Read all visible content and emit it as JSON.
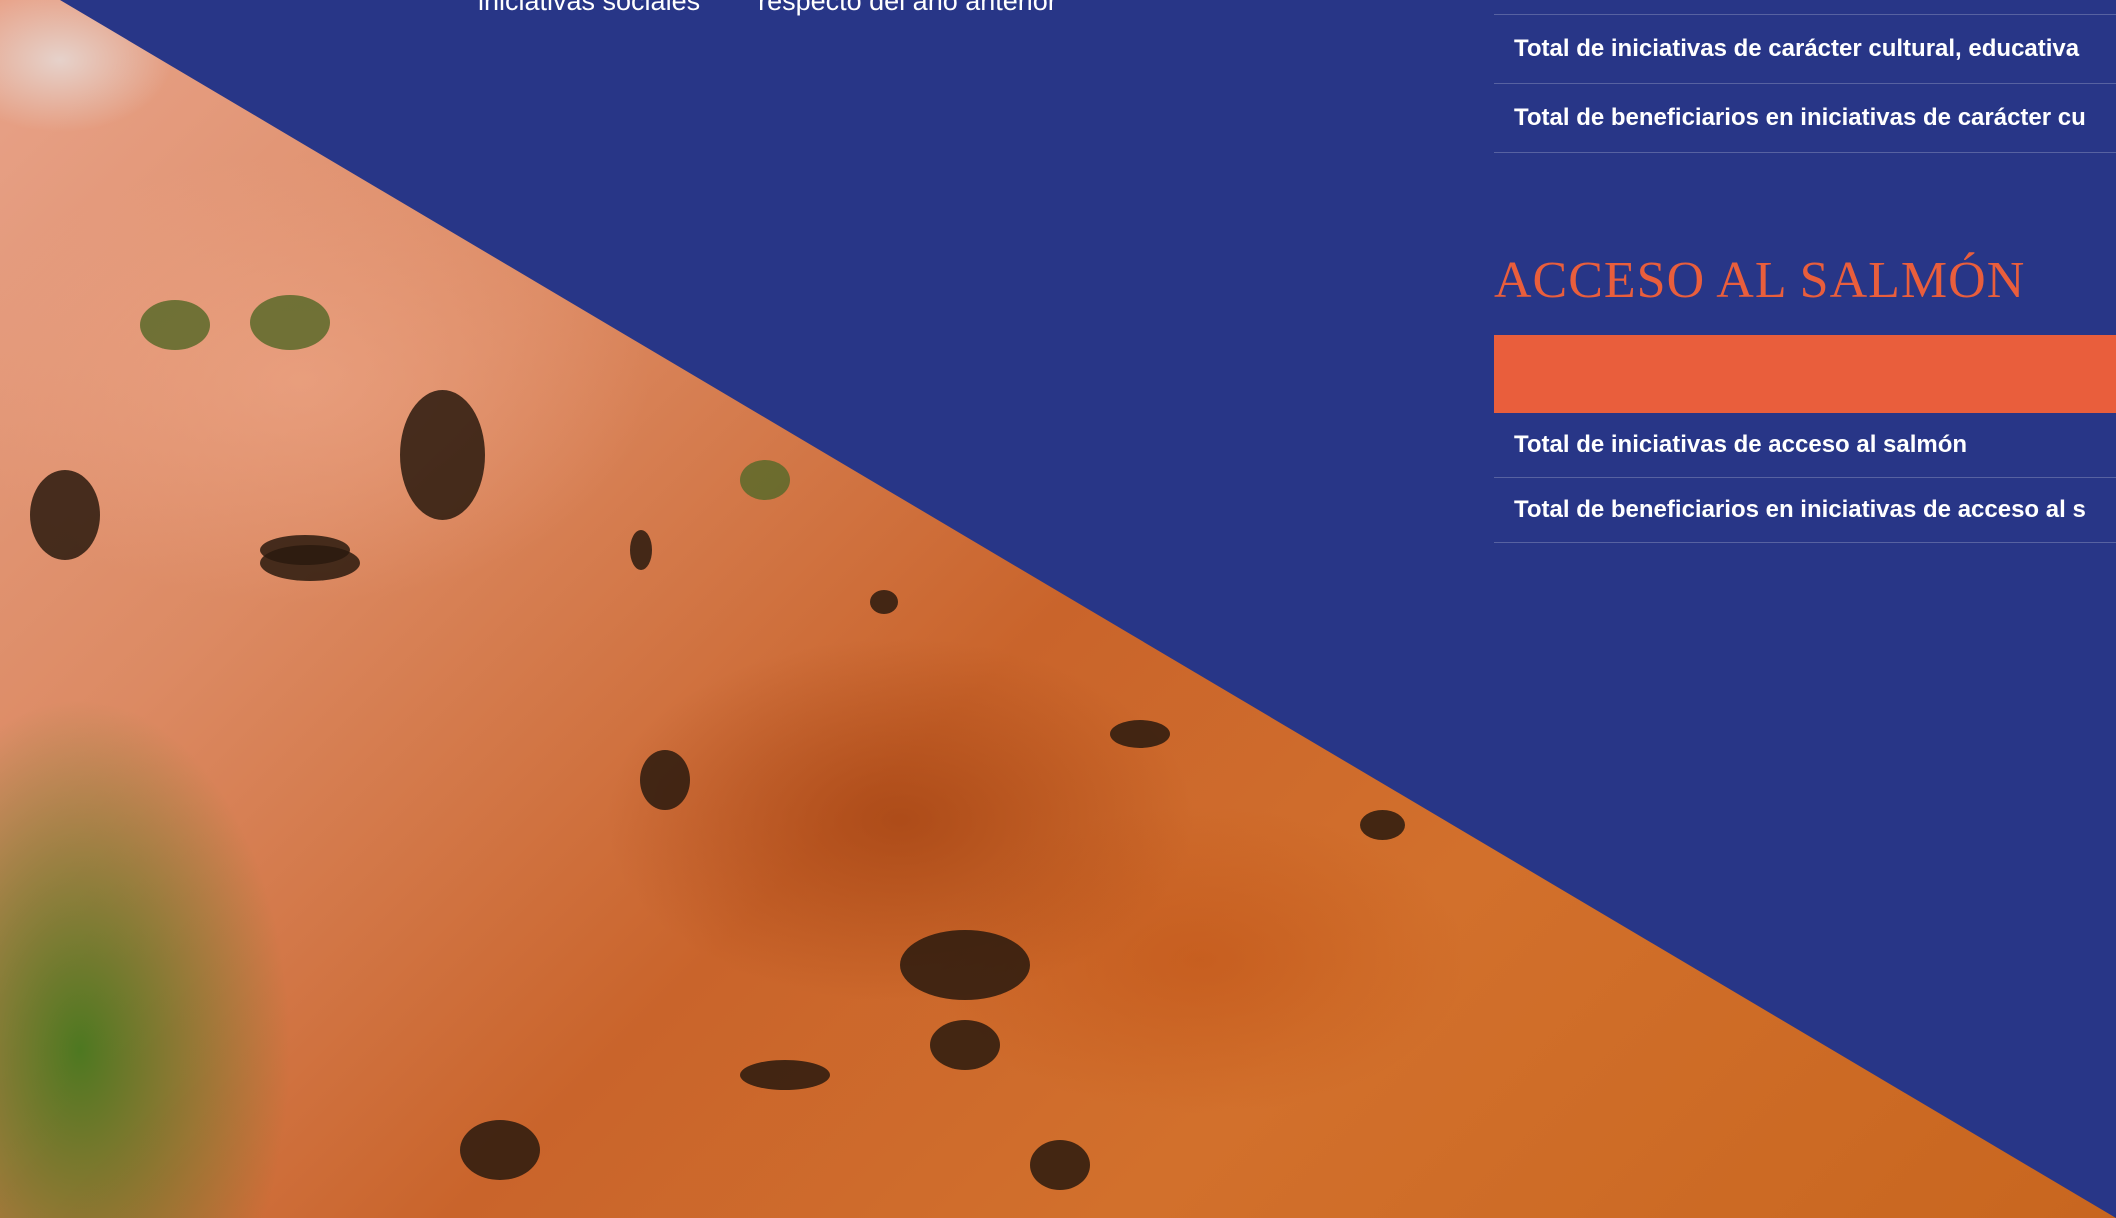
{
  "header_labels": {
    "left": "iniciativas sociales",
    "right": "respecto del año anterior"
  },
  "cultural_section": {
    "rows": [
      "Total de iniciativas de carácter cultural, educativa",
      "Total de beneficiarios en iniciativas de carácter cu"
    ]
  },
  "salmon_section": {
    "title": "ACCESO AL SALMÓN",
    "rows": [
      "Total de iniciativas de acceso al salmón",
      "Total de beneficiarios en iniciativas de acceso al s"
    ]
  },
  "colors": {
    "background": "#283687",
    "accent": "#e95e3c",
    "text": "#ffffff"
  }
}
